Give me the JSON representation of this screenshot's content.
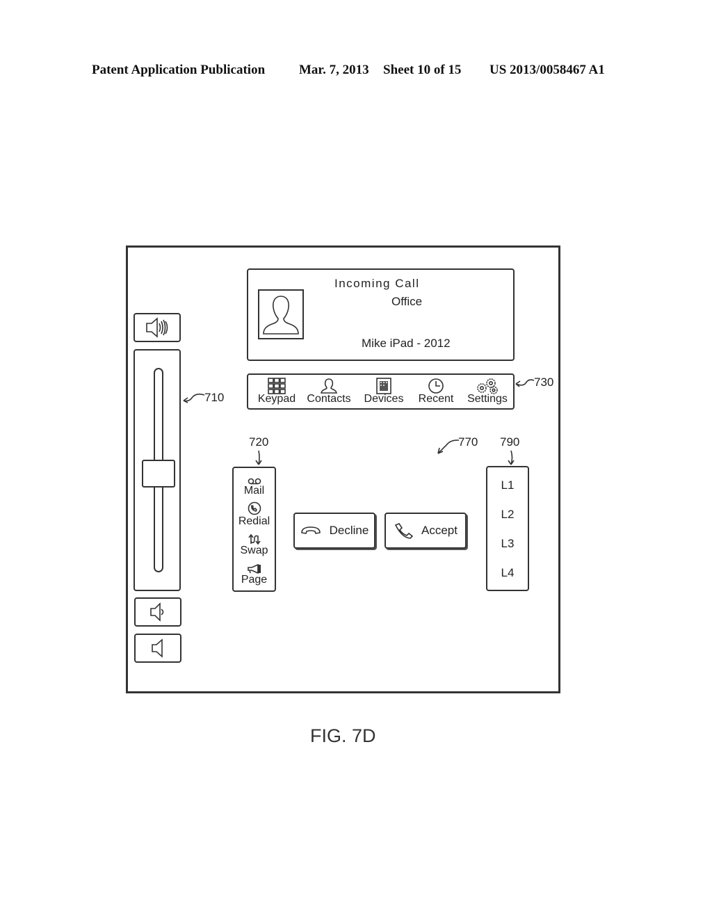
{
  "header": {
    "publication": "Patent Application Publication",
    "date": "Mar. 7, 2013",
    "sheet": "Sheet 10 of 15",
    "number": "US 2013/0058467 A1"
  },
  "call_panel": {
    "title": "Incoming Call",
    "caller": "Office",
    "device": "Mike iPad - 2012",
    "avatar_icon": "person-silhouette-icon"
  },
  "nav": {
    "ref": "730",
    "items": [
      {
        "label": "Keypad",
        "icon": "keypad-icon"
      },
      {
        "label": "Contacts",
        "icon": "contacts-icon"
      },
      {
        "label": "Devices",
        "icon": "devices-icon"
      },
      {
        "label": "Recent",
        "icon": "clock-icon"
      },
      {
        "label": "Settings",
        "icon": "gears-icon"
      }
    ]
  },
  "volume": {
    "ref": "710",
    "level_fraction": 0.48,
    "buttons": [
      {
        "name": "volume-high",
        "icon": "speaker-loud-icon"
      },
      {
        "name": "volume-low",
        "icon": "speaker-soft-icon"
      },
      {
        "name": "volume-mute",
        "icon": "speaker-off-icon"
      }
    ]
  },
  "side_menu": {
    "ref": "720",
    "items": [
      {
        "label": "Mail",
        "icon": "voicemail-icon"
      },
      {
        "label": "Redial",
        "icon": "redial-icon"
      },
      {
        "label": "Swap",
        "icon": "swap-icon"
      },
      {
        "label": "Page",
        "icon": "megaphone-icon"
      }
    ]
  },
  "actions": {
    "ref": "770",
    "decline": "Decline",
    "accept": "Accept"
  },
  "lines": {
    "ref": "790",
    "items": [
      "L1",
      "L2",
      "L3",
      "L4"
    ]
  },
  "figure_caption": "FIG. 7D"
}
